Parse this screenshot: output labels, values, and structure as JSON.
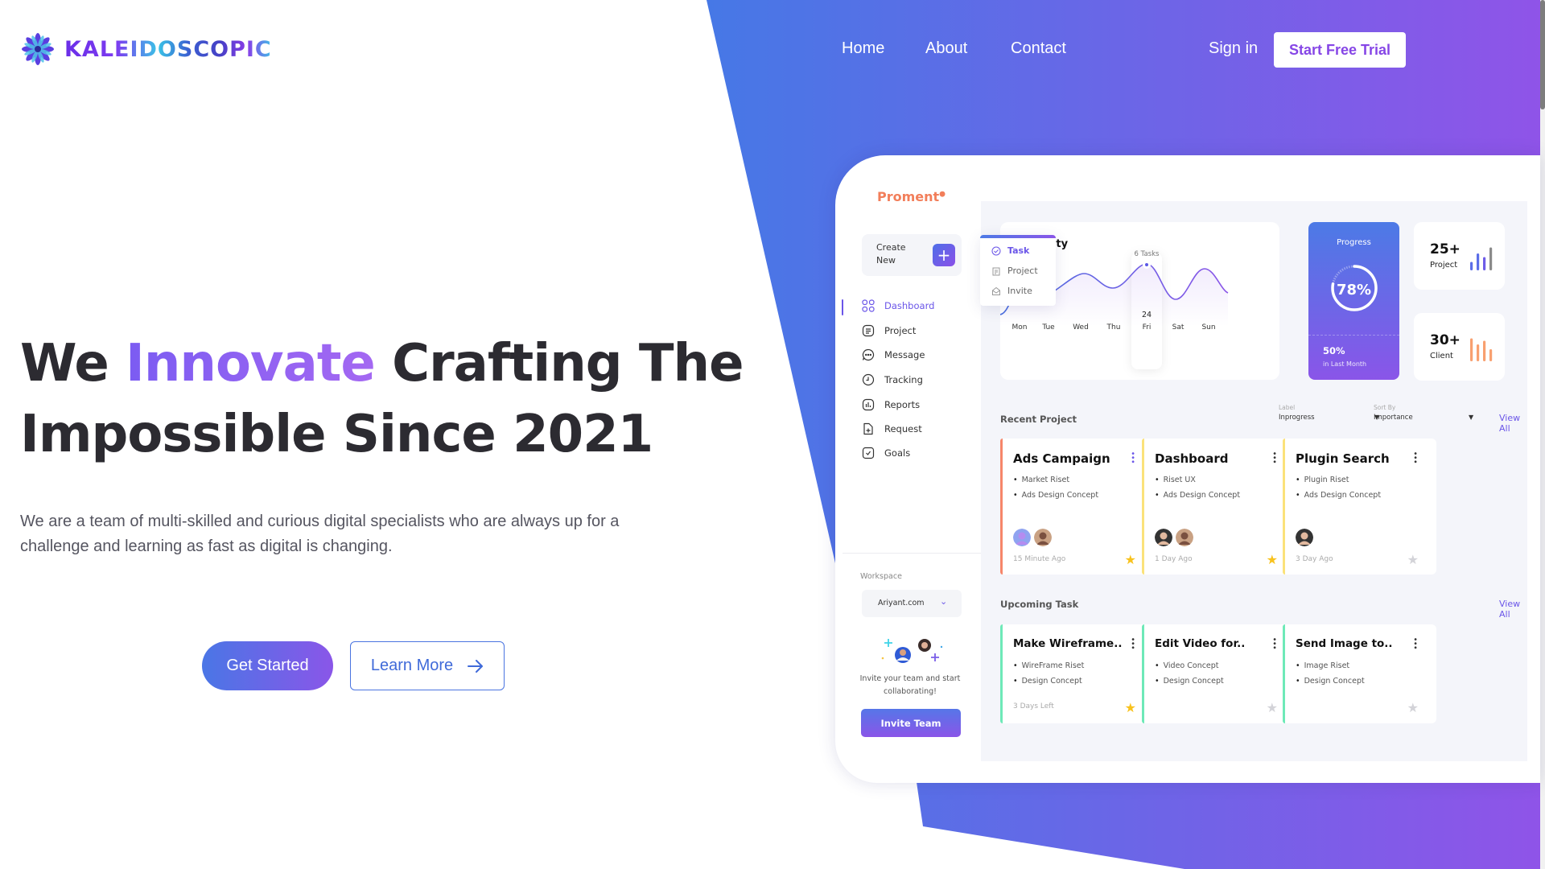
{
  "brand": {
    "name": "KALEIDOSCOPIC",
    "colors": {
      "primary": "#4a76e6",
      "accent": "#8a56e8"
    }
  },
  "nav": {
    "items": [
      {
        "label": "Home"
      },
      {
        "label": "About"
      },
      {
        "label": "Contact"
      }
    ],
    "sign_in": "Sign in",
    "cta": "Start Free Trial"
  },
  "hero": {
    "title_prefix": "We ",
    "title_accent": "Innovate",
    "title_suffix": " Crafting The",
    "title_line2": "Impossible Since 2021",
    "paragraph": "We are a team of multi-skilled and curious digital specialists who are always up for a challenge and learning as fast as digital is changing.",
    "primary_button": "Get Started",
    "secondary_button": "Learn More",
    "secondary_icon": "arrow-right-icon"
  },
  "mockup": {
    "app_name": "Proment",
    "create_new": "Create New",
    "create_menu": [
      {
        "label": "Task",
        "icon": "check-circle-icon",
        "active": true
      },
      {
        "label": "Project",
        "icon": "clipboard-icon",
        "active": false
      },
      {
        "label": "Invite",
        "icon": "envelope-icon",
        "active": false
      }
    ],
    "sidebar": [
      {
        "label": "Dashboard",
        "icon": "grid-icon",
        "active": true
      },
      {
        "label": "Project",
        "icon": "document-icon"
      },
      {
        "label": "Message",
        "icon": "chat-icon"
      },
      {
        "label": "Tracking",
        "icon": "clock-icon"
      },
      {
        "label": "Reports",
        "icon": "bar-chart-icon"
      },
      {
        "label": "Request",
        "icon": "file-plus-icon"
      },
      {
        "label": "Goals",
        "icon": "checkbox-icon"
      }
    ],
    "workspace": {
      "label": "Workspace",
      "value": "Ariyant.com"
    },
    "invite": {
      "text": "Invite your team and start collaborating!",
      "button": "Invite Team"
    },
    "activity": {
      "title": "Activity",
      "visible_title": "ivity",
      "days": [
        "Mon",
        "Tue",
        "Wed",
        "Thu",
        "Fri",
        "Sat",
        "Sun"
      ],
      "highlight": {
        "day": "Fri",
        "date": "24",
        "tooltip": "6 Tasks"
      }
    },
    "progress": {
      "title": "Progress",
      "value": "78%",
      "percent": 78,
      "sub_value": "50%",
      "sub_label": "in Last Month"
    },
    "stats": [
      {
        "value": "25+",
        "label": "Project",
        "bars": [
          0.35,
          0.7,
          0.55,
          0.95
        ],
        "bar_colors": [
          "#5b6ee8",
          "#5b6ee8",
          "#6f5de8",
          "#8a8a8a"
        ]
      },
      {
        "value": "30+",
        "label": "Client",
        "bars": [
          0.95,
          0.7,
          0.85,
          0.5
        ],
        "bar_colors": [
          "#f8a070",
          "#f8a070",
          "#f8a070",
          "#f8a070"
        ]
      }
    ],
    "recent": {
      "title": "Recent Project",
      "filter_label": {
        "label": "Label",
        "value": "Inprogress"
      },
      "sort_by": {
        "label": "Sort By",
        "value": "Importance"
      },
      "view_all": "View All",
      "cards": [
        {
          "title": "Ads Campaign",
          "items": [
            "Market Riset",
            "Ads Design Concept"
          ],
          "time": "15 Minute Ago",
          "starred": true,
          "bar": "#f6866a",
          "avatars": 2,
          "dots_color": "#6a55e8"
        },
        {
          "title": "Dashboard",
          "items": [
            "Riset UX",
            "Ads Design Concept"
          ],
          "time": "1 Day Ago",
          "starred": true,
          "bar": "#fbe27a",
          "avatars": 2,
          "dots_color": "#333"
        },
        {
          "title": "Plugin Search",
          "items": [
            "Plugin Riset",
            "Ads Design Concept"
          ],
          "time": "3 Day Ago",
          "starred": false,
          "bar": "#fbe27a",
          "avatars": 1,
          "dots_color": "#333"
        }
      ]
    },
    "upcoming": {
      "title": "Upcoming Task",
      "view_all": "View All",
      "cards": [
        {
          "title": "Make Wireframe..",
          "items": [
            "WireFrame Riset",
            "Design Concept"
          ],
          "time": "3 Days Left",
          "starred": true,
          "bar": "#6ee9b8"
        },
        {
          "title": "Edit Video for..",
          "items": [
            "Video Concept",
            "Design Concept"
          ],
          "time": "",
          "starred": false,
          "bar": "#6ee9b8"
        },
        {
          "title": "Send Image to..",
          "items": [
            "Image Riset",
            "Design Concept"
          ],
          "time": "",
          "starred": false,
          "bar": "#6ee9b8"
        }
      ]
    }
  }
}
